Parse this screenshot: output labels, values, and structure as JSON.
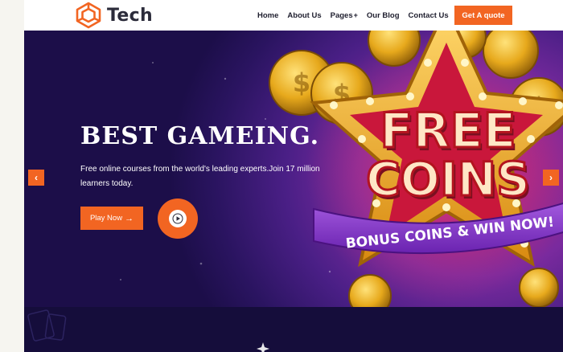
{
  "brand": {
    "name": "Tech",
    "accent": "#f26522",
    "text_color": "#2b2b3a"
  },
  "nav": {
    "items": [
      {
        "label": "Home"
      },
      {
        "label": "About Us"
      },
      {
        "label": "Pages",
        "suffix": "+"
      },
      {
        "label": "Our Blog"
      },
      {
        "label": "Contact Us"
      }
    ],
    "cta": "Get A quote"
  },
  "hero": {
    "title": "BEST GAMEING.",
    "subtitle": "Free online courses from the world's leading experts.Join 17 million learners today.",
    "play_label": "Play Now",
    "play_icon": "arrow-right-icon",
    "video_icon": "play-circle-icon",
    "prev_icon": "chevron-left-icon",
    "next_icon": "chevron-right-icon",
    "art": {
      "line1": "FREE",
      "line2": "COINS",
      "ribbon": "BONUS COINS & WIN NOW!"
    },
    "colors": {
      "bg_dark": "#1c0e49",
      "bg_glow": "#b0237c",
      "ribbon": "#8a3bd1"
    }
  }
}
